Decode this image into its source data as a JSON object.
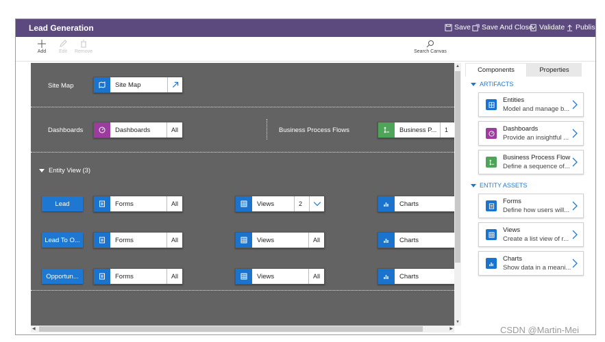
{
  "app": {
    "title": "Lead Generation"
  },
  "titlebar": {
    "save": "Save",
    "save_and_close": "Save And Close",
    "validate": "Validate",
    "publish": "Publish"
  },
  "commands": {
    "add": "Add",
    "edit": "Edit",
    "remove": "Remove",
    "search_canvas": "Search Canvas"
  },
  "canvas": {
    "site_map_row": {
      "label": "Site Map",
      "card": "Site Map"
    },
    "dashboards_row": {
      "label": "Dashboards",
      "card": "Dashboards",
      "count": "All"
    },
    "bpf_row": {
      "label": "Business Process Flows",
      "card": "Business P...",
      "count": "1"
    },
    "entity_view": {
      "label": "Entity View (3)"
    },
    "entities": [
      {
        "name": "Lead",
        "forms": "Forms",
        "forms_count": "All",
        "views": "Views",
        "views_count": "2",
        "charts": "Charts"
      },
      {
        "name": "Lead To O...",
        "forms": "Forms",
        "forms_count": "All",
        "views": "Views",
        "views_count": "All",
        "charts": "Charts"
      },
      {
        "name": "Opportun...",
        "forms": "Forms",
        "forms_count": "All",
        "views": "Views",
        "views_count": "All",
        "charts": "Charts"
      }
    ]
  },
  "panel": {
    "tabs": [
      "Components",
      "Properties"
    ],
    "artifacts_header": "ARTIFACTS",
    "artifacts": [
      {
        "title": "Entities",
        "desc": "Model and manage b...",
        "icon": "entities-icon",
        "color": "#1a73cc"
      },
      {
        "title": "Dashboards",
        "desc": "Provide an insightful ...",
        "icon": "dashboard-icon",
        "color": "#9b3c9e"
      },
      {
        "title": "Business Process Flow",
        "desc": "Define a sequence of...",
        "icon": "process-flow-icon",
        "color": "#4ea55a"
      }
    ],
    "entity_assets_header": "ENTITY ASSETS",
    "entity_assets": [
      {
        "title": "Forms",
        "desc": "Define how users will...",
        "icon": "form-icon",
        "color": "#1a73cc"
      },
      {
        "title": "Views",
        "desc": "Create a list view of r...",
        "icon": "grid-icon",
        "color": "#1a73cc"
      },
      {
        "title": "Charts",
        "desc": "Show data in a meani...",
        "icon": "chart-icon",
        "color": "#1a73cc"
      }
    ]
  },
  "colors": {
    "titlebar": "#5c4a7f",
    "canvas": "#636363",
    "accent": "#1e78d1"
  },
  "watermark": "CSDN @Martin-Mei"
}
